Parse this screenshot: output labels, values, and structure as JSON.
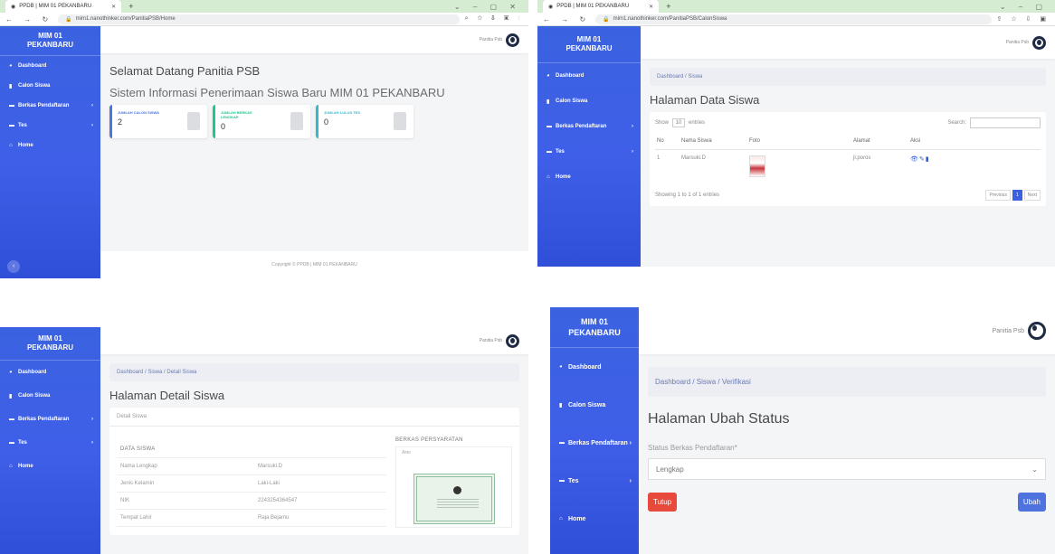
{
  "brand": {
    "line1": "MIM 01",
    "line2": "PEKANBARU"
  },
  "user_label": "Panitia Psb",
  "menu": [
    {
      "label": "Dashboard",
      "icon": "dashboard-icon",
      "glyph": "◕"
    },
    {
      "label": "Calon Siswa",
      "icon": "student-icon",
      "glyph": "▮"
    },
    {
      "label": "Berkas Pendaftaran",
      "icon": "document-icon",
      "glyph": "▬",
      "chevron": "›"
    },
    {
      "label": "Tes",
      "icon": "test-icon",
      "glyph": "▬",
      "chevron": "›"
    },
    {
      "label": "Home",
      "icon": "home-icon",
      "glyph": "⌂"
    }
  ],
  "browser": {
    "tab_title": "PPDB | MIM 01 PEKANBARU",
    "url_home": "mim1.nanothinker.com/PanitiaPSB/Home",
    "url_siswa": "mim1.nanothinker.com/PanitiaPSB/CalonSiswa"
  },
  "dashboard": {
    "welcome": "Selamat Datang Panitia PSB",
    "subtitle": "Sistem Informasi Penerimaan Siswa Baru MIM 01 PEKANBARU",
    "cards": [
      {
        "label": "JUMLAH CALON SISWA",
        "value": "2",
        "color": "#4e73df"
      },
      {
        "label": "JUMLAH BERKAS LENGKAP",
        "value": "0",
        "color": "#1cc88a"
      },
      {
        "label": "JUMLAH LULUS TES",
        "value": "0",
        "color": "#36b9cc"
      }
    ],
    "footer": "Copyright © PPDB | MIM 01 PEKANBARU"
  },
  "siswa": {
    "breadcrumb": "Dashboard / Siswa",
    "title": "Halaman Data Siswa",
    "show_label": "Show",
    "show_value": "10",
    "entries_label": "entries",
    "search_label": "Search:",
    "columns": [
      "No",
      "Nama Siswa",
      "Foto",
      "Alamat",
      "Aksi"
    ],
    "rows": [
      {
        "no": "1",
        "nama": "Marsuki.D",
        "alamat": "jl.poros"
      }
    ],
    "info": "Showing 1 to 1 of 1 entries",
    "prev": "Previous",
    "page": "1",
    "next": "Next"
  },
  "detail": {
    "breadcrumb": "Dashboard / Siswa / Detail Siswa",
    "title": "Halaman Detail Siswa",
    "card_title": "Detail Siswa",
    "data_heading": "DATA SISWA",
    "fields": [
      {
        "label": "Nama Lengkap",
        "value": "Marsuki.D"
      },
      {
        "label": "Jenis Kelamin",
        "value": "Laki-Laki"
      },
      {
        "label": "NIK",
        "value": "2243254364547"
      },
      {
        "label": "Tempat Lahir",
        "value": "Raja Bejamu"
      }
    ],
    "berkas_heading": "BERKAS PERSYARATAN",
    "akte_label": "Akte"
  },
  "ubah": {
    "breadcrumb": "Dashboard / Siswa / Verifikasi",
    "title": "Halaman Ubah Status",
    "field_label": "Status Berkas Pendaftaran*",
    "selected": "Lengkap",
    "close_label": "Tutup",
    "submit_label": "Ubah"
  }
}
